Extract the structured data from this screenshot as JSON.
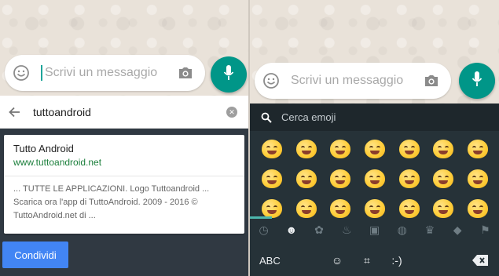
{
  "left": {
    "composer_placeholder": "Scrivi un messaggio",
    "search_query": "tuttoandroid",
    "result": {
      "title": "Tutto Android",
      "url": "www.tuttoandroid.net",
      "snippet": "... TUTTE LE APPLICAZIONI. Logo Tuttoandroid ... Scarica ora l'app di TuttoAndroid. 2009 - 2016 © TuttoAndroid.net di ..."
    },
    "share_label": "Condividi"
  },
  "right": {
    "composer_placeholder": "Scrivi un messaggio",
    "emoji_search_placeholder": "Cerca emoji",
    "categories": [
      "clock-icon",
      "smiley-icon",
      "gear-icon",
      "celebration-icon",
      "car-icon",
      "basketball-icon",
      "crown-icon",
      "diamond-icon",
      "flag-icon"
    ],
    "bottom": {
      "abc_label": "ABC",
      "emoticon_label": ":-)"
    }
  },
  "colors": {
    "accent": "#009688",
    "keyboard_bg": "#263238",
    "share_button": "#4285f4",
    "url_green": "#1b7f3b"
  }
}
